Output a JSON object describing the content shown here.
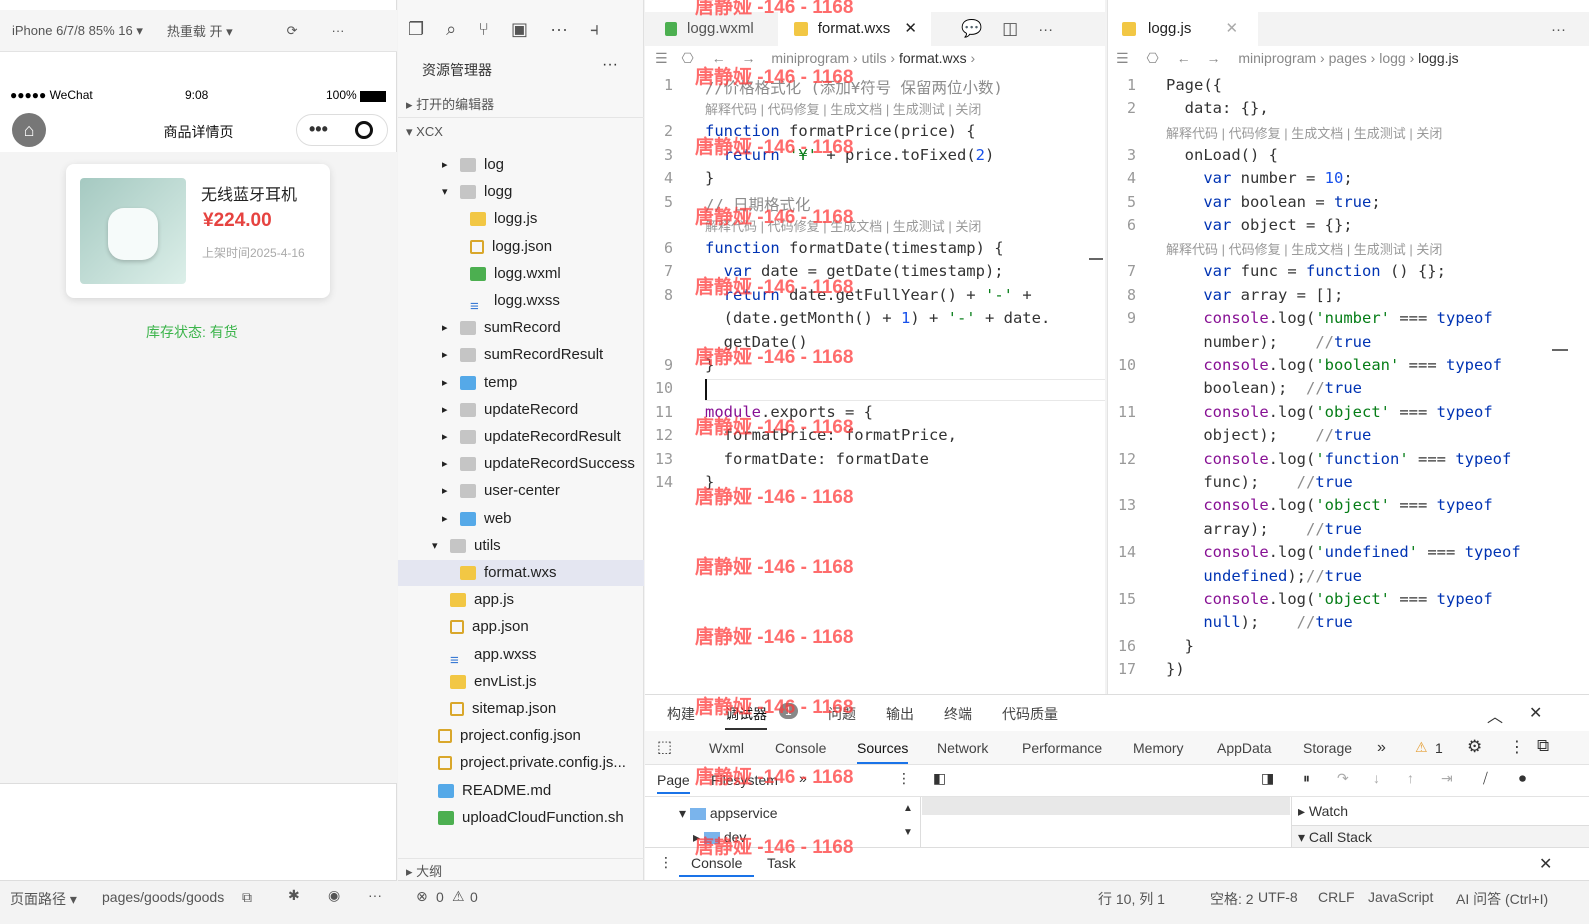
{
  "simulator": {
    "device": "iPhone 6/7/8 85% 16 ▾",
    "hot_reload": "热重载 开 ▾",
    "status_carrier": "●●●●● WeChat",
    "status_time": "9:08",
    "status_battery": "100%",
    "page_title": "商品详情页",
    "product": {
      "name": "无线蓝牙耳机",
      "price": "¥224.00",
      "date": "上架时间2025-4-16"
    },
    "stock": "库存状态: 有货",
    "footer_path_label": "页面路径 ▾",
    "footer_path": "pages/goods/goods"
  },
  "explorer": {
    "title": "资源管理器",
    "open_editors": "打开的编辑器",
    "root": "XCX",
    "outline": "大纲",
    "items": [
      {
        "name": "log",
        "indent": 2,
        "type": "folder",
        "arrow": "▸"
      },
      {
        "name": "logg",
        "indent": 2,
        "type": "folder",
        "arrow": "▾"
      },
      {
        "name": "logg.js",
        "indent": 3,
        "type": "js"
      },
      {
        "name": "logg.json",
        "indent": 3,
        "type": "json"
      },
      {
        "name": "logg.wxml",
        "indent": 3,
        "type": "wxml"
      },
      {
        "name": "logg.wxss",
        "indent": 3,
        "type": "wxss"
      },
      {
        "name": "sumRecord",
        "indent": 2,
        "type": "folder",
        "arrow": "▸"
      },
      {
        "name": "sumRecordResult",
        "indent": 2,
        "type": "folder",
        "arrow": "▸"
      },
      {
        "name": "temp",
        "indent": 2,
        "type": "folder-blue",
        "arrow": "▸"
      },
      {
        "name": "updateRecord",
        "indent": 2,
        "type": "folder",
        "arrow": "▸"
      },
      {
        "name": "updateRecordResult",
        "indent": 2,
        "type": "folder",
        "arrow": "▸"
      },
      {
        "name": "updateRecordSuccess",
        "indent": 2,
        "type": "folder",
        "arrow": "▸"
      },
      {
        "name": "user-center",
        "indent": 2,
        "type": "folder",
        "arrow": "▸"
      },
      {
        "name": "web",
        "indent": 2,
        "type": "folder-blue",
        "arrow": "▸"
      },
      {
        "name": "utils",
        "indent": 1,
        "type": "folder",
        "arrow": "▾"
      },
      {
        "name": "format.wxs",
        "indent": 2,
        "type": "js",
        "selected": true
      },
      {
        "name": "app.js",
        "indent": 1,
        "type": "js"
      },
      {
        "name": "app.json",
        "indent": 1,
        "type": "json"
      },
      {
        "name": "app.wxss",
        "indent": 1,
        "type": "wxss"
      },
      {
        "name": "envList.js",
        "indent": 1,
        "type": "js"
      },
      {
        "name": "sitemap.json",
        "indent": 1,
        "type": "json"
      },
      {
        "name": "project.config.json",
        "indent": 0,
        "type": "json"
      },
      {
        "name": "project.private.config.js...",
        "indent": 0,
        "type": "json"
      },
      {
        "name": "README.md",
        "indent": 0,
        "type": "folder-blue"
      },
      {
        "name": "uploadCloudFunction.sh",
        "indent": 0,
        "type": "wxml"
      }
    ]
  },
  "editor_left": {
    "tabs": [
      "logg.wxml",
      "format.wxs"
    ],
    "breadcrumb": [
      "miniprogram",
      "utils",
      "format.wxs"
    ],
    "lens": "解释代码 | 代码修复 | 生成文档 | 生成测试 | 关闭",
    "lines": [
      {
        "n": "1",
        "t": "//价格格式化 (添加¥符号 保留两位小数)",
        "c": "cm"
      },
      {
        "n": "2",
        "t": "function formatPrice(price) {"
      },
      {
        "n": "3",
        "t": "  return '¥' + price.toFixed(2)"
      },
      {
        "n": "4",
        "t": "}"
      },
      {
        "n": "5",
        "t": "// 日期格式化",
        "c": "cm"
      },
      {
        "n": "6",
        "t": "function formatDate(timestamp) {"
      },
      {
        "n": "7",
        "t": "  var date = getDate(timestamp);"
      },
      {
        "n": "8",
        "t": "  return date.getFullYear() + '-' +"
      },
      {
        "n": "",
        "t": "  (date.getMonth() + 1) + '-' + date."
      },
      {
        "n": "",
        "t": "  getDate()"
      },
      {
        "n": "9",
        "t": "}"
      },
      {
        "n": "10",
        "t": ""
      },
      {
        "n": "11",
        "t": "module.exports = {"
      },
      {
        "n": "12",
        "t": "  formatPrice: formatPrice,"
      },
      {
        "n": "13",
        "t": "  formatDate: formatDate"
      },
      {
        "n": "14",
        "t": "}"
      }
    ]
  },
  "editor_right": {
    "tab": "logg.js",
    "breadcrumb": [
      "miniprogram",
      "pages",
      "logg",
      "logg.js"
    ],
    "lines": [
      {
        "n": "1",
        "t": "Page({"
      },
      {
        "n": "2",
        "t": "  data: {},"
      },
      {
        "n": "3",
        "t": "  onLoad() {"
      },
      {
        "n": "4",
        "t": "    var number = 10;"
      },
      {
        "n": "5",
        "t": "    var boolean = true;"
      },
      {
        "n": "6",
        "t": "    var object = {};"
      },
      {
        "n": "7",
        "t": "    var func = function () {};"
      },
      {
        "n": "8",
        "t": "    var array = [];"
      },
      {
        "n": "9",
        "t": "    console.log('number' === typeof"
      },
      {
        "n": "",
        "t": "    number);    //true"
      },
      {
        "n": "10",
        "t": "    console.log('boolean' === typeof"
      },
      {
        "n": "",
        "t": "    boolean);  //true"
      },
      {
        "n": "11",
        "t": "    console.log('object' === typeof"
      },
      {
        "n": "",
        "t": "    object);    //true"
      },
      {
        "n": "12",
        "t": "    console.log('function' === typeof"
      },
      {
        "n": "",
        "t": "    func);    //true"
      },
      {
        "n": "13",
        "t": "    console.log('object' === typeof"
      },
      {
        "n": "",
        "t": "    array);    //true"
      },
      {
        "n": "14",
        "t": "    console.log('undefined' === typeof"
      },
      {
        "n": "",
        "t": "    undefined);//true"
      },
      {
        "n": "15",
        "t": "    console.log('object' === typeof"
      },
      {
        "n": "",
        "t": "    null);    //true"
      },
      {
        "n": "16",
        "t": "  }"
      },
      {
        "n": "17",
        "t": "})"
      }
    ]
  },
  "panel": {
    "tabs": [
      "构建",
      "调试器",
      "问题",
      "输出",
      "终端",
      "代码质量"
    ],
    "badge": "1",
    "devtools_tabs": [
      "Wxml",
      "Console",
      "Sources",
      "Network",
      "Performance",
      "Memory",
      "AppData",
      "Storage"
    ],
    "warn": "1",
    "sources_left": [
      "Page",
      "Filesystem"
    ],
    "tree": [
      "appservice",
      "dev"
    ],
    "watch": "Watch",
    "callstack": "Call Stack",
    "drawer": [
      "Console",
      "Task"
    ]
  },
  "status": {
    "errors": "0",
    "warnings": "0",
    "pos": "行 10, 列 1",
    "spaces": "空格: 2",
    "enc": "UTF-8",
    "eol": "CRLF",
    "lang": "JavaScript",
    "ai": "AI 问答 (Ctrl+I)"
  },
  "watermark": "唐静娅 -146 - 1168"
}
